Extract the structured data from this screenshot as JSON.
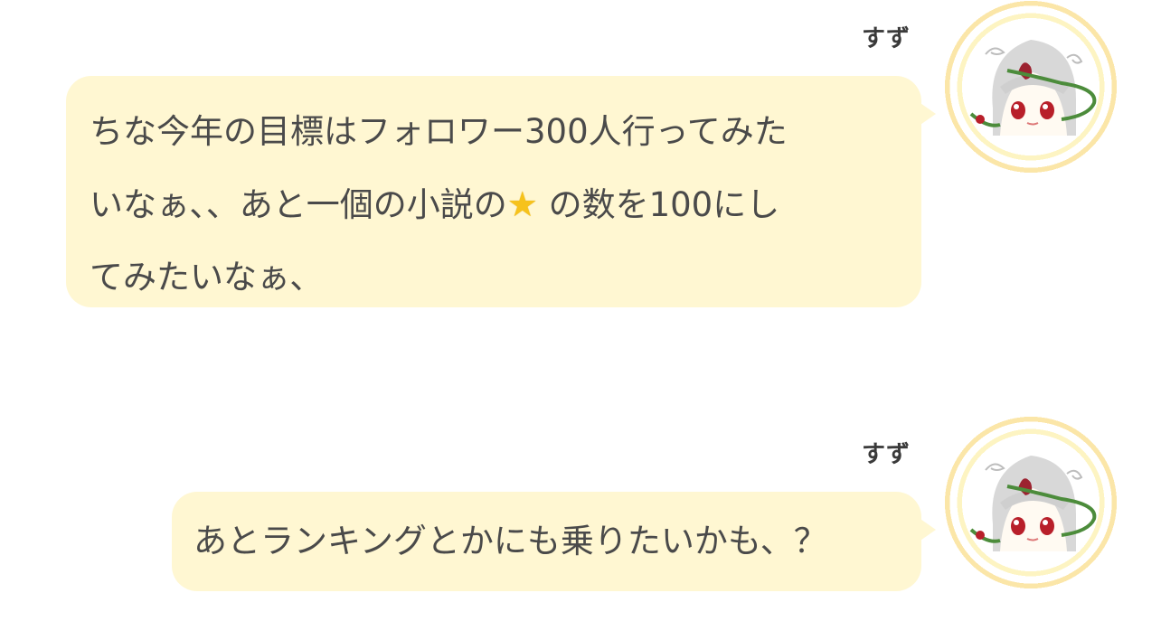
{
  "messages": [
    {
      "sender": "すず",
      "line1": "ちな今年の目標はフォロワー300人行ってみた",
      "line2_before_star": "いなぁ、、あと一個の小説の",
      "star_icon": "star-icon",
      "line2_after_star": " の数を100にし",
      "line3": "てみたいなぁ、"
    },
    {
      "sender": "すず",
      "text": "あとランキングとかにも乗りたいかも、？"
    }
  ],
  "colors": {
    "bubble": "#fff7d2",
    "text": "#4a4a4a",
    "avatar_ring": "#f8c9c7"
  }
}
